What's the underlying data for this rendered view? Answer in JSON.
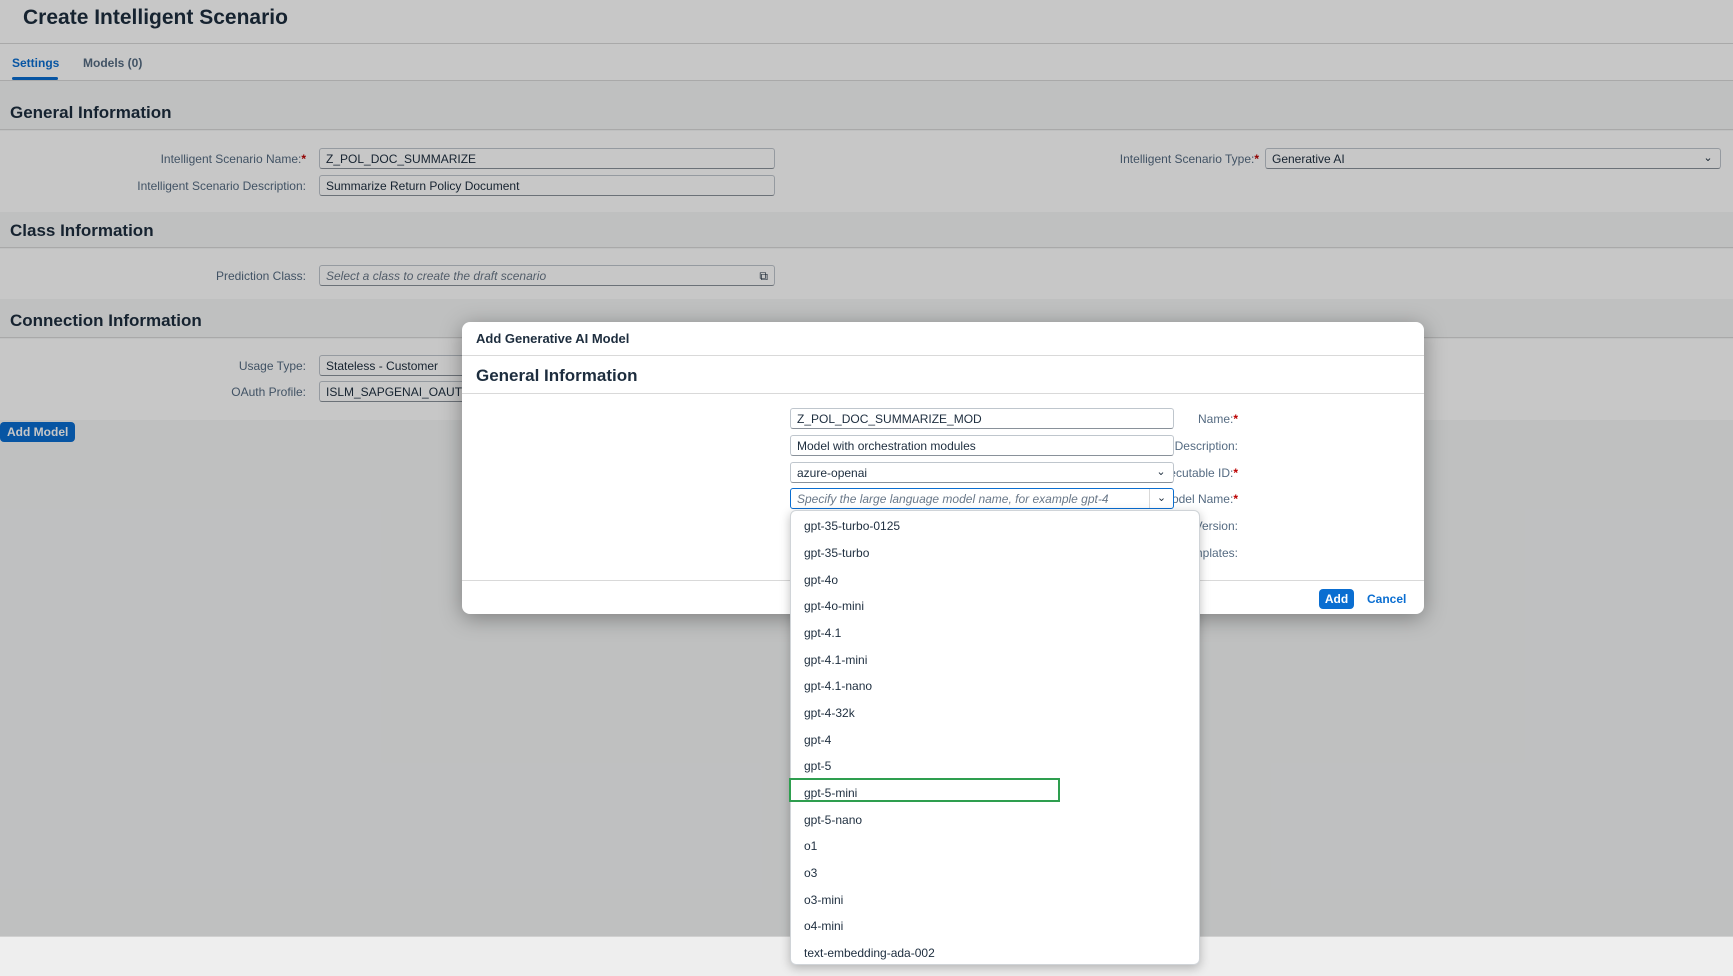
{
  "page": {
    "title": "Create Intelligent Scenario"
  },
  "tabs": [
    {
      "label": "Settings",
      "active": true
    },
    {
      "label": "Models (0)",
      "active": false
    }
  ],
  "general_information": {
    "title": "General Information",
    "name_label": "Intelligent Scenario Name:",
    "name_value": "Z_POL_DOC_SUMMARIZE",
    "description_label": "Intelligent Scenario Description:",
    "description_value": "Summarize Return Policy Document",
    "type_label": "Intelligent Scenario Type:",
    "type_value": "Generative AI"
  },
  "class_information": {
    "title": "Class Information",
    "prediction_class_label": "Prediction Class:",
    "prediction_class_placeholder": "Select a class to create the draft scenario"
  },
  "connection_information": {
    "title": "Connection Information",
    "usage_type_label": "Usage Type:",
    "usage_type_value": "Stateless - Customer",
    "oauth_profile_label": "OAuth Profile:",
    "oauth_profile_value": "ISLM_SAPGENAI_OAUTH_"
  },
  "add_model_button": "Add Model",
  "required_marker": "*",
  "dialog": {
    "title": "Add Generative AI Model",
    "section_title": "General Information",
    "name_label": "Name:",
    "name_value": "Z_POL_DOC_SUMMARIZE_MOD",
    "description_label": "Description:",
    "description_value": "Model with orchestration modules",
    "executable_id_label": "Executable ID:",
    "executable_id_value": "azure-openai",
    "llm_name_label": "Large Language Model Name:",
    "llm_name_placeholder": "Specify the large language model name, for example gpt-4",
    "model_version_label": "Model Version:",
    "prompt_templates_label": "Model contains prompt templates:",
    "add_button": "Add",
    "cancel_button": "Cancel"
  },
  "dropdown": {
    "highlighted": "gpt-5-mini",
    "options": [
      "gpt-35-turbo-0125",
      "gpt-35-turbo",
      "gpt-4o",
      "gpt-4o-mini",
      "gpt-4.1",
      "gpt-4.1-mini",
      "gpt-4.1-nano",
      "gpt-4-32k",
      "gpt-4",
      "gpt-5",
      "gpt-5-mini",
      "gpt-5-nano",
      "o1",
      "o3",
      "o3-mini",
      "o4-mini",
      "text-embedding-ada-002"
    ]
  },
  "colors": {
    "accent": "#0a6ed1",
    "highlight_border": "#2e9e4f",
    "required": "#bb0000"
  },
  "icons": {
    "value_help": "value-help-icon",
    "dropdown_arrow": "chevron-down-icon"
  }
}
